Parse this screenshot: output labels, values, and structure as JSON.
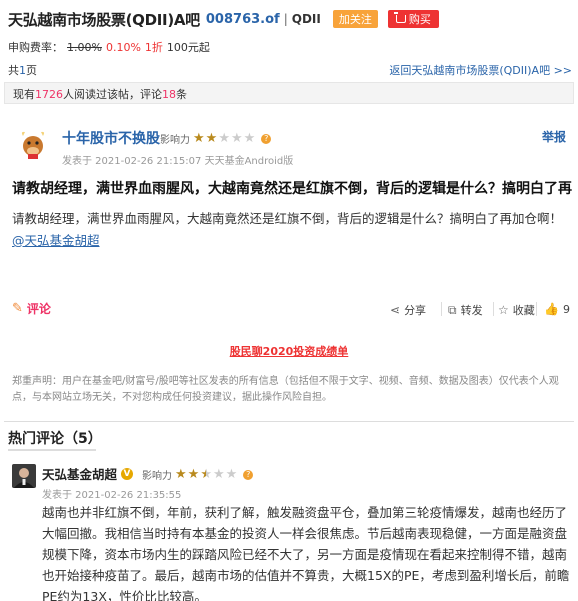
{
  "header": {
    "title": "天弘越南市场股票(QDII)A吧",
    "code": "008763.of",
    "separator": "|",
    "tag": "QDII",
    "follow_label": "加关注",
    "buy_label": "购买"
  },
  "fees": {
    "label": "申购费率：",
    "original": "1.00%",
    "current": "0.10%",
    "discount": "1折",
    "minimum": "100元起"
  },
  "pager": {
    "prefix": "共",
    "pages": "1",
    "suffix": "页",
    "back_link": "返回天弘越南市场股票(QDII)A吧 >>"
  },
  "stats": {
    "text1": "现有",
    "readers": "1726",
    "text2": "人阅读过该帖，评论",
    "comments": "18",
    "text3": "条"
  },
  "post": {
    "author": "十年股市不换股",
    "influence_label": "影响力",
    "influence_stars": 2,
    "meta": "发表于 2021-02-26 21:15:07 天天基金Android版",
    "report_label": "举报",
    "title": "请教胡经理，满世界血雨腥风，大越南竟然还是红旗不倒，背后的逻辑是什么？搞明白了再",
    "body": "请教胡经理，满世界血雨腥风，大越南竟然还是红旗不倒，背后的逻辑是什么？搞明白了再加仓啊！",
    "mention": "@天弘基金胡超",
    "actions": {
      "comment": "评论",
      "share": "分享",
      "repost": "转发",
      "favorite": "收藏",
      "likes": "9"
    },
    "promo": "股民聊2020投资成绩单",
    "disclaimer": "郑重声明：用户在基金吧/财富号/股吧等社区发表的所有信息（包括但不限于文字、视频、音频、数据及图表）仅代表个人观点，与本网站立场无关，不对您构成任何投资建议，据此操作风险自担。"
  },
  "hot_comments": {
    "title": "热门评论（5）"
  },
  "comment": {
    "author": "天弘基金胡超",
    "badge": "V",
    "influence_label": "影响力",
    "influence_stars": 2.5,
    "meta": "发表于 2021-02-26 21:35:55",
    "body": "越南也并非红旗不倒，年前，获利了解，触发融资盘平仓，叠加第三轮疫情爆发，越南也经历了大幅回撤。我相信当时持有本基金的投资人一样会很焦虑。节后越南表现稳健，一方面是融资盘规模下降，资本市场内生的踩踏风险已经不大了，另一方面是疫情现在看起来控制得不错，越南也开始接种疫苗了。最后，越南市场的估值并不算贵，大概15X的PE，考虑到盈利增长后，前瞻PE约为13X，性价比比较高。"
  },
  "colors": {
    "link": "#2a64a9",
    "accent_red": "#e33",
    "follow_orange": "#f8a33a",
    "star_gold": "#b98a1e"
  }
}
